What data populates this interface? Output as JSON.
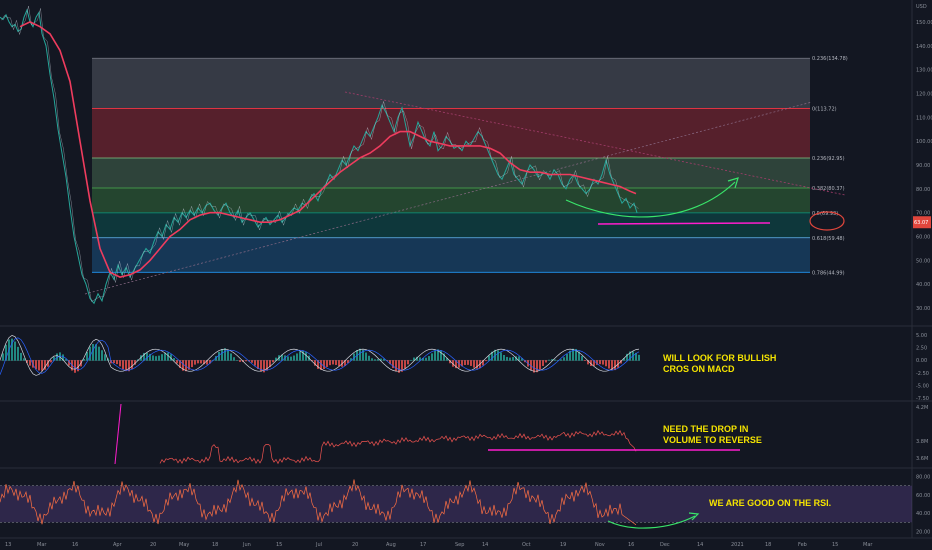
{
  "chart_data": [
    {
      "type": "line",
      "panel": "price",
      "y_ticks": [
        30,
        40,
        50,
        60,
        70,
        80,
        90,
        100,
        110,
        120,
        130,
        140,
        150
      ],
      "yaxis_top_label": "USD",
      "x_labels": [
        "13",
        "Mar",
        "16",
        "Apr",
        "20",
        "May",
        "18",
        "Jun",
        "15",
        "Jul",
        "20",
        "Aug",
        "17",
        "Sep",
        "14",
        "Oct",
        "19",
        "Nov",
        "16",
        "Dec",
        "14",
        "2021",
        "18",
        "Feb",
        "15",
        "Mar"
      ],
      "price_series": {
        "x": [
          0,
          3,
          6,
          9,
          12,
          15,
          18,
          21,
          24,
          27,
          30,
          33,
          36,
          39,
          42,
          46,
          50,
          54,
          58,
          62,
          66,
          70,
          74,
          78,
          82,
          86,
          90,
          94,
          98,
          102,
          106,
          110,
          114,
          118,
          122,
          126,
          130,
          134,
          138,
          142,
          146,
          150,
          154,
          158,
          162,
          166,
          170,
          174,
          178,
          182,
          186,
          190,
          194,
          198,
          202,
          206,
          210,
          214,
          218,
          222,
          226,
          230,
          234,
          238,
          242,
          246,
          250,
          254,
          258,
          262,
          266,
          270,
          274,
          278,
          282,
          286,
          290,
          294,
          298,
          302,
          306,
          310,
          314,
          318,
          322,
          326,
          330,
          334,
          338,
          342,
          346,
          350,
          354,
          358,
          362,
          366,
          370,
          374,
          378,
          382,
          386,
          390,
          394,
          398,
          402,
          406,
          410,
          414,
          418,
          422,
          426,
          430,
          434,
          438,
          442,
          446,
          450,
          454,
          458,
          462,
          466,
          470,
          474,
          478,
          482,
          486,
          490,
          494,
          498,
          502,
          506,
          510,
          514,
          518,
          522,
          526,
          530,
          534,
          538,
          542,
          546,
          550,
          554,
          558,
          562,
          566,
          570,
          574,
          578,
          582,
          586,
          590,
          594,
          598,
          602,
          606,
          610,
          614,
          618,
          622,
          626,
          630,
          634,
          637
        ],
        "y": [
          152,
          151,
          153,
          150,
          148,
          149,
          146,
          147,
          152,
          155,
          150,
          148,
          152,
          154,
          145,
          140,
          128,
          118,
          105,
          95,
          85,
          72,
          60,
          52,
          44,
          40,
          34,
          32,
          36,
          33,
          40,
          45,
          42,
          48,
          44,
          47,
          43,
          46,
          49,
          52,
          55,
          53,
          58,
          62,
          60,
          65,
          63,
          68,
          66,
          70,
          68,
          71,
          69,
          72,
          70,
          73,
          74,
          71,
          69,
          72,
          74,
          70,
          68,
          71,
          66,
          68,
          70,
          67,
          64,
          66,
          68,
          65,
          67,
          69,
          66,
          68,
          70,
          72,
          71,
          74,
          73,
          76,
          78,
          75,
          80,
          82,
          86,
          84,
          88,
          92,
          90,
          94,
          98,
          96,
          100,
          104,
          102,
          106,
          110,
          115,
          112,
          108,
          104,
          110,
          114,
          106,
          98,
          102,
          108,
          104,
          100,
          98,
          104,
          96,
          98,
          102,
          100,
          97,
          98,
          96,
          100,
          98,
          101,
          104,
          102,
          98,
          94,
          90,
          86,
          84,
          88,
          92,
          86,
          84,
          82,
          86,
          90,
          88,
          85,
          86,
          87,
          84,
          88,
          86,
          82,
          80,
          84,
          86,
          82,
          80,
          78,
          80,
          84,
          82,
          86,
          92,
          86,
          82,
          78,
          74,
          76,
          72,
          74,
          70
        ]
      },
      "ma_series": {
        "x": [
          20,
          30,
          40,
          50,
          60,
          70,
          80,
          90,
          100,
          110,
          120,
          130,
          140,
          150,
          160,
          170,
          180,
          190,
          200,
          210,
          220,
          230,
          240,
          250,
          260,
          270,
          280,
          290,
          300,
          310,
          320,
          330,
          340,
          350,
          360,
          370,
          380,
          390,
          400,
          410,
          420,
          430,
          440,
          450,
          460,
          470,
          480,
          490,
          500,
          510,
          520,
          530,
          540,
          550,
          560,
          570,
          580,
          590,
          600,
          610,
          620,
          630,
          636
        ],
        "y": [
          148,
          150,
          148,
          145,
          138,
          125,
          100,
          75,
          55,
          45,
          43,
          44,
          46,
          50,
          55,
          60,
          63,
          67,
          69,
          70,
          70,
          69,
          68,
          67,
          66,
          66,
          67,
          69,
          71,
          75,
          79,
          83,
          87,
          90,
          93,
          95,
          98,
          102,
          104,
          104,
          102,
          100,
          99,
          98,
          98,
          98,
          98,
          97,
          95,
          91,
          88,
          87,
          87,
          86,
          86,
          86,
          85,
          84,
          83,
          82,
          81,
          79,
          78
        ]
      },
      "fibonacci": [
        {
          "level": "0.236",
          "value": 134.78,
          "label": "0.236(134.78)"
        },
        {
          "level": "0",
          "value": 113.72,
          "label": "0(113.72)"
        },
        {
          "level": "0.236",
          "value": 92.95,
          "label": "0.236(92.95)"
        },
        {
          "level": "0.382",
          "value": 80.37,
          "label": "0.382(80.37)"
        },
        {
          "level": "0.5",
          "value": 69.93,
          "label": "0.5(69.93)"
        },
        {
          "level": "0.618",
          "value": 59.48,
          "label": "0.618(59.48)"
        },
        {
          "level": "0.786",
          "value": 44.99,
          "label": "0.786(44.99)"
        }
      ],
      "current_price_badge": "63.07",
      "ylim": [
        25,
        155
      ]
    },
    {
      "type": "bar",
      "panel": "macd",
      "y_ticks": [
        "5.00",
        "2.50",
        "0.00",
        "-2.50",
        "-5.00",
        "-7.50"
      ],
      "ylim": [
        -7.5,
        6
      ],
      "annotation": [
        "WILL LOOK FOR BULLISH",
        "CROS ON MACD"
      ]
    },
    {
      "type": "line",
      "panel": "volume",
      "y_ticks": [
        "4.2M",
        "3.8M",
        "3.6M"
      ],
      "annotation": [
        "NEED THE DROP IN",
        "VOLUME TO REVERSE"
      ]
    },
    {
      "type": "line",
      "panel": "rsi",
      "y_ticks": [
        "80.00",
        "60.00",
        "40.00",
        "20.00"
      ],
      "ylim": [
        15,
        85
      ],
      "bands": [
        70,
        30
      ],
      "annotation": [
        "WE ARE GOOD ON THE RSI."
      ]
    }
  ],
  "colors": {
    "background": "#131722",
    "price": "#26a69a",
    "ma": "#ef3c5e",
    "annotation": "#f5e400",
    "arrow": "#39e46a",
    "magenta": "#ff1dce"
  }
}
